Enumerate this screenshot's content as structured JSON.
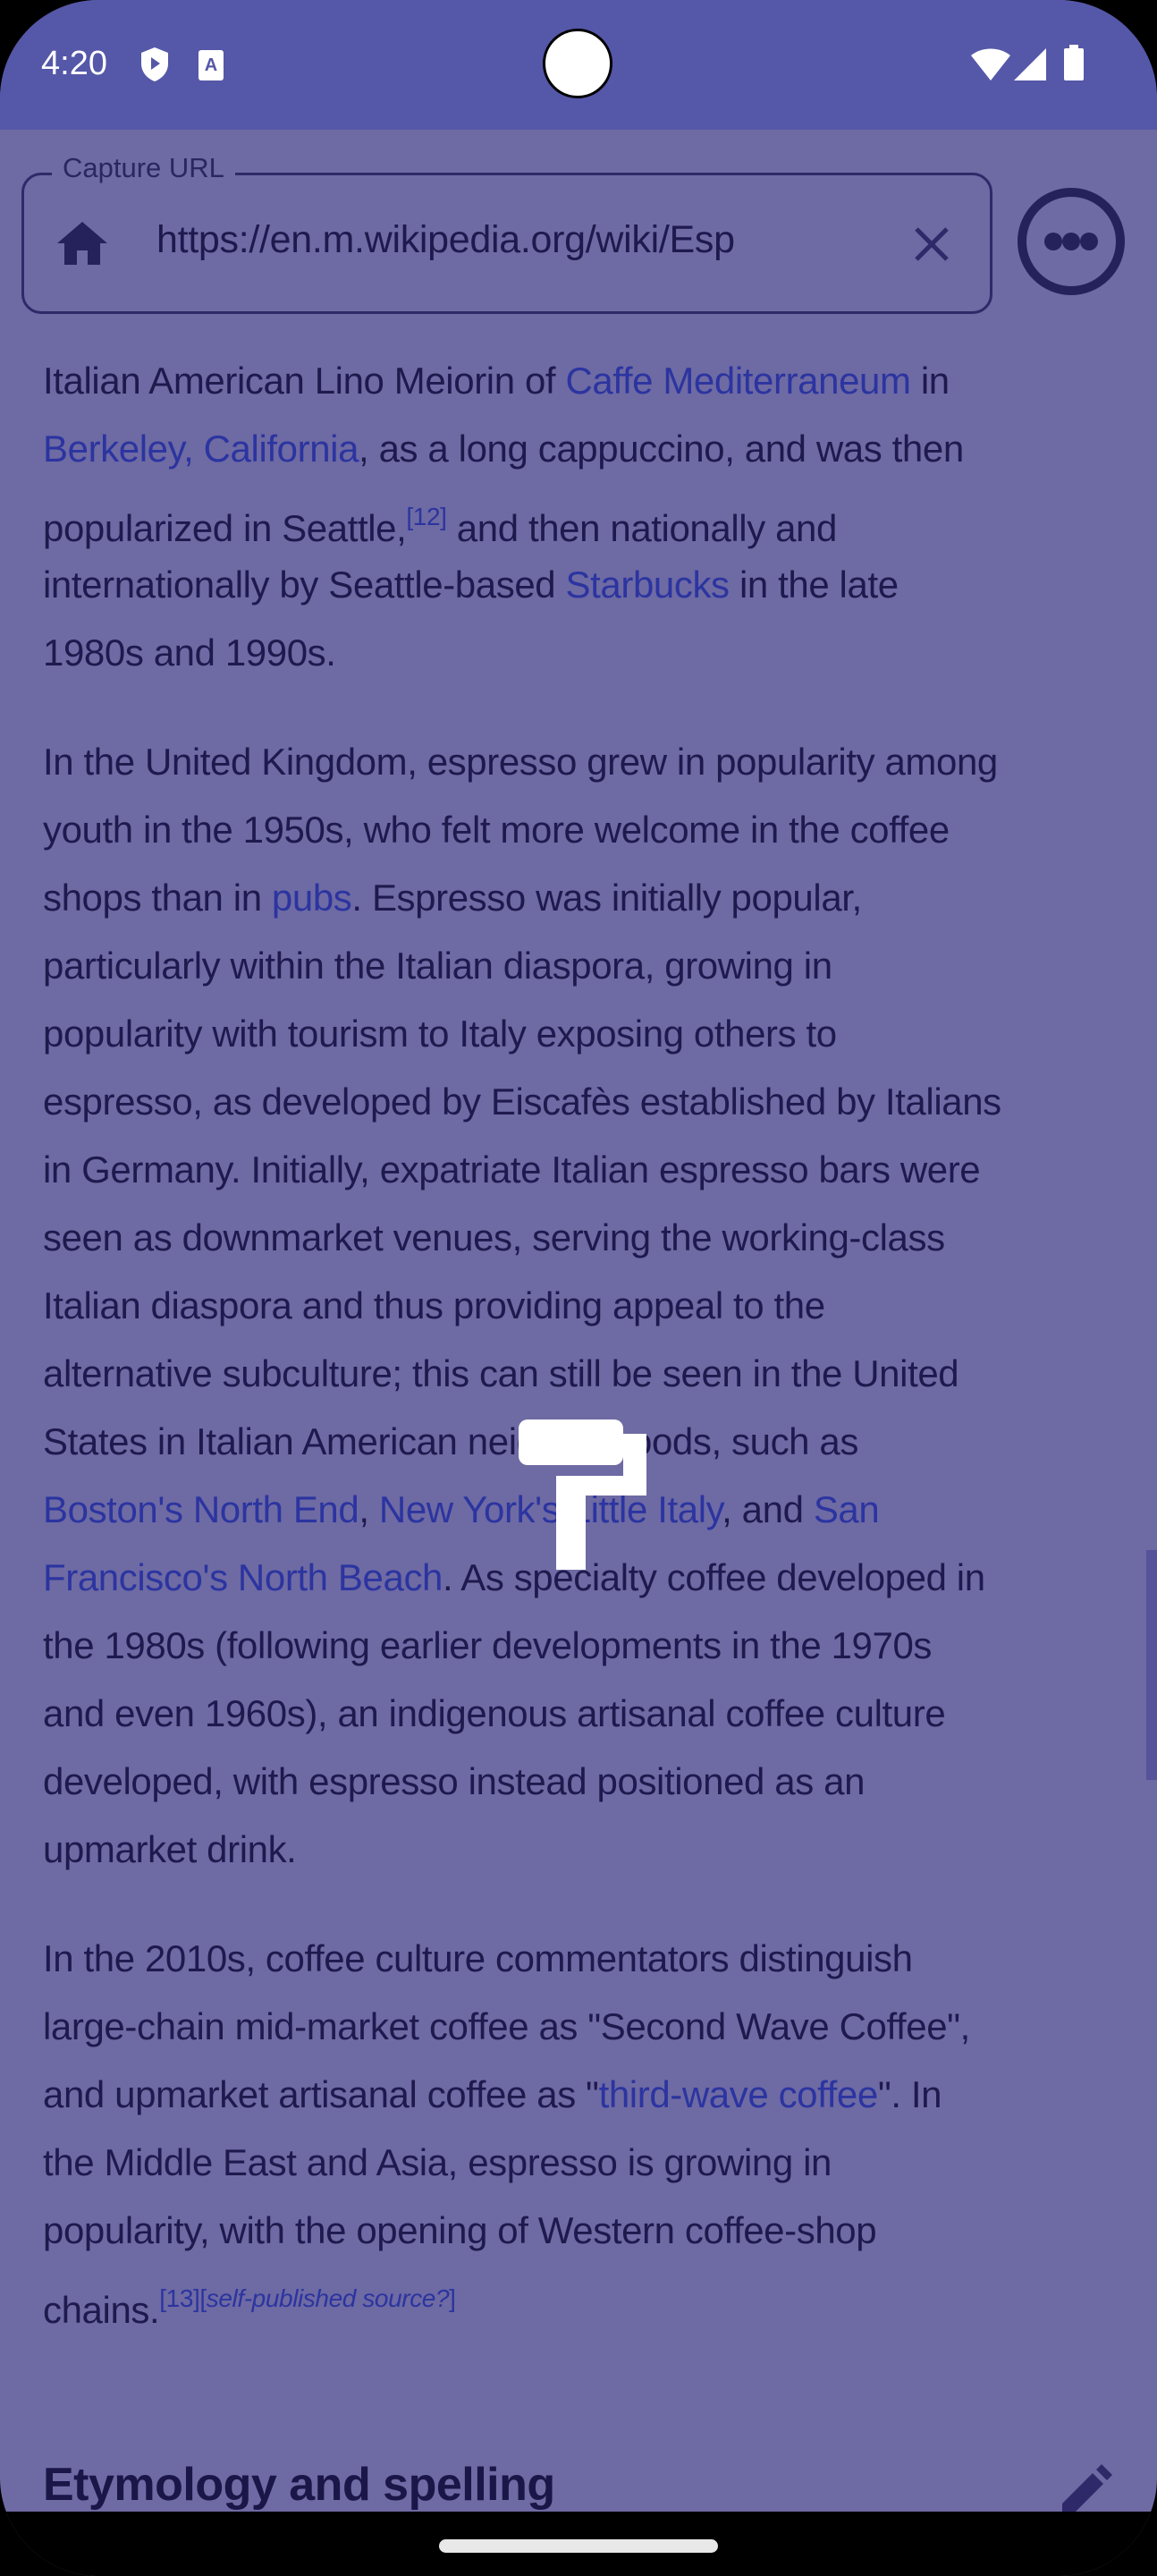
{
  "status_bar": {
    "time": "4:20",
    "icons": [
      "shield-play-icon",
      "font-a-icon",
      "wifi-icon",
      "signal-icon",
      "battery-icon"
    ]
  },
  "url_bar": {
    "label": "Capture URL",
    "value": "https://en.m.wikipedia.org/wiki/Esp",
    "home_icon": "home-icon",
    "clear_icon": "close-icon",
    "more_icon": "more-horizontal-icon"
  },
  "colors": {
    "status_bar": "#5557a8",
    "background": "#6e6aa3",
    "text": "#1e1a4e",
    "link": "#2b34a0"
  },
  "article": {
    "paragraphs": [
      [
        [
          {
            "t": "Italian American Lino Meiorin of "
          },
          {
            "t": "Caffe Mediterraneum",
            "link": true
          },
          {
            "t": " in"
          }
        ],
        [
          {
            "t": "Berkeley, California",
            "link": true
          },
          {
            "t": ", as a long cappuccino, and was then"
          }
        ],
        [
          {
            "t": "popularized in Seattle,"
          },
          {
            "t": "[12]",
            "sup": true
          },
          {
            "t": " and then nationally and"
          }
        ],
        [
          {
            "t": "internationally by Seattle-based "
          },
          {
            "t": "Starbucks",
            "link": true
          },
          {
            "t": " in the late"
          }
        ],
        [
          {
            "t": "1980s and 1990s."
          }
        ]
      ],
      [
        [
          {
            "t": "In the United Kingdom, espresso grew in popularity among"
          }
        ],
        [
          {
            "t": "youth in the 1950s, who felt more welcome in the coffee"
          }
        ],
        [
          {
            "t": "shops than in "
          },
          {
            "t": "pubs",
            "link": true
          },
          {
            "t": ". Espresso was initially popular,"
          }
        ],
        [
          {
            "t": "particularly within the Italian diaspora, growing in"
          }
        ],
        [
          {
            "t": "popularity with tourism to Italy exposing others to"
          }
        ],
        [
          {
            "t": "espresso, as developed by Eiscafès established by Italians"
          }
        ],
        [
          {
            "t": "in Germany. Initially, expatriate Italian espresso bars were"
          }
        ],
        [
          {
            "t": "seen as downmarket venues, serving the working-class"
          }
        ],
        [
          {
            "t": "Italian diaspora and thus providing appeal to the"
          }
        ],
        [
          {
            "t": "alternative subculture; this can still be seen in the United"
          }
        ],
        [
          {
            "t": "States in Italian American neighborhoods, such as"
          }
        ],
        [
          {
            "t": "Boston's North End",
            "link": true
          },
          {
            "t": ", "
          },
          {
            "t": "New York's Little Italy",
            "link": true
          },
          {
            "t": ", and "
          },
          {
            "t": "San",
            "link": true
          }
        ],
        [
          {
            "t": "Francisco's North Beach",
            "link": true
          },
          {
            "t": ". As specialty coffee developed in"
          }
        ],
        [
          {
            "t": "the 1980s (following earlier developments in the 1970s"
          }
        ],
        [
          {
            "t": "and even 1960s), an indigenous artisanal coffee culture"
          }
        ],
        [
          {
            "t": "developed, with espresso instead positioned as an"
          }
        ],
        [
          {
            "t": "upmarket drink."
          }
        ]
      ],
      [
        [
          {
            "t": "In the 2010s, coffee culture commentators distinguish"
          }
        ],
        [
          {
            "t": "large-chain mid-market coffee as \"Second Wave Coffee\","
          }
        ],
        [
          {
            "t": "and upmarket artisanal coffee as \""
          },
          {
            "t": "third-wave coffee",
            "link": true
          },
          {
            "t": "\". In"
          }
        ],
        [
          {
            "t": "the Middle East and Asia, espresso is growing in"
          }
        ],
        [
          {
            "t": "popularity, with the opening of Western coffee-shop"
          }
        ],
        [
          {
            "t": "chains."
          },
          {
            "t": "[13]",
            "sup": true
          },
          {
            "t": "[",
            "sup": true,
            "plain": true
          },
          {
            "t": "self-published source?",
            "sup": true,
            "italic": true
          },
          {
            "t": "]",
            "sup": true,
            "plain": true
          }
        ]
      ]
    ],
    "section_heading": "Etymology and spelling",
    "edit_icon": "pencil-icon"
  },
  "overlay_icon": "paint-roller-icon",
  "scroll_position_percent": 62
}
